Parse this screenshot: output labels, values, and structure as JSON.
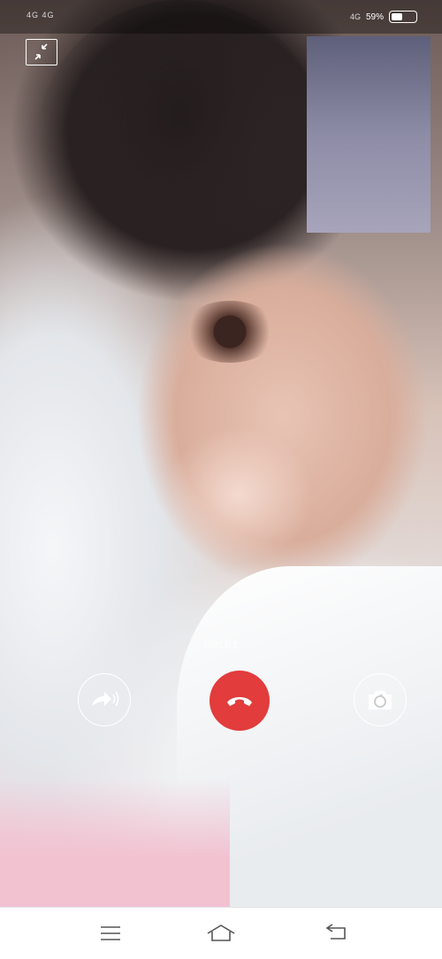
{
  "status_bar": {
    "left_text": "4G 4G",
    "network": "4G",
    "battery": "59%"
  },
  "call": {
    "timer": "00:01"
  },
  "icons": {
    "minimize": "minimize-icon",
    "speaker": "speaker-icon",
    "hangup": "hangup-icon",
    "camera": "camera-switch-icon",
    "menu": "menu-icon",
    "home": "home-icon",
    "back": "back-icon"
  },
  "colors": {
    "hangup": "#e23c3c",
    "navbar": "#ffffff"
  }
}
